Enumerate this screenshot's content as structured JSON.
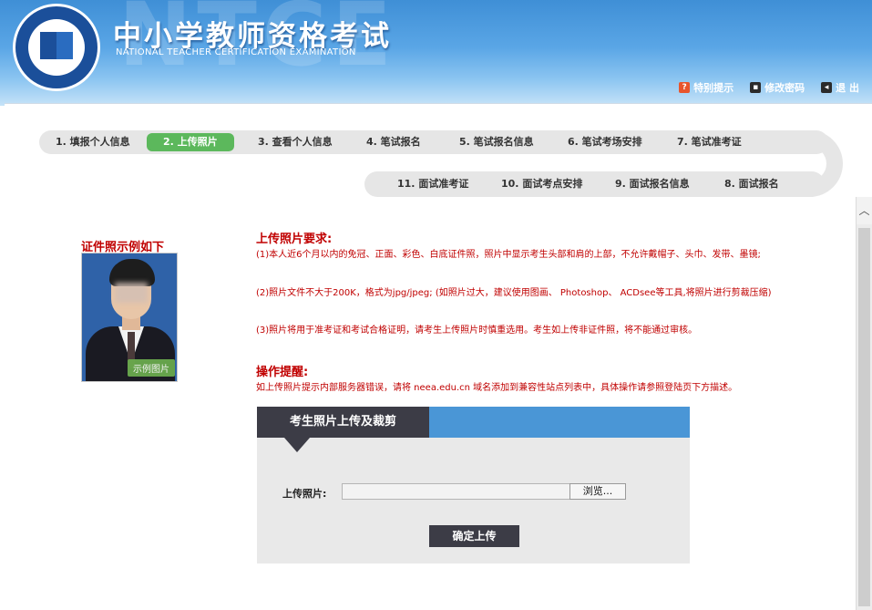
{
  "header": {
    "watermark": "NTCE",
    "title": "中小学教师资格考试",
    "subtitle": "NATIONAL TEACHER CERTIFICATION EXAMINATION",
    "links": [
      {
        "label": "特别提示",
        "icon": "notice-icon",
        "color": "#e8552d"
      },
      {
        "label": "修改密码",
        "icon": "password-icon",
        "color": "#2b2b2b"
      },
      {
        "label": "退 出",
        "icon": "logout-icon",
        "color": "#2b2b2b"
      }
    ]
  },
  "steps": {
    "top": [
      {
        "label": "1. 填报个人信息"
      },
      {
        "label": "2. 上传照片",
        "active": true
      },
      {
        "label": "3. 查看个人信息"
      },
      {
        "label": "4. 笔试报名"
      },
      {
        "label": "5. 笔试报名信息"
      },
      {
        "label": "6. 笔试考场安排"
      },
      {
        "label": "7. 笔试准考证"
      }
    ],
    "bottom": [
      {
        "label": "11. 面试准考证"
      },
      {
        "label": "10. 面试考点安排"
      },
      {
        "label": "9. 面试报名信息"
      },
      {
        "label": "8. 面试报名"
      }
    ],
    "active_color": "#5cb85c"
  },
  "sample": {
    "title": "证件照示例如下",
    "tag": "示例图片"
  },
  "requirements": {
    "title": "上传照片要求:",
    "items": [
      "(1)本人近6个月以内的免冠、正面、彩色、白底证件照，照片中显示考生头部和肩的上部，不允许戴帽子、头巾、发带、墨镜;",
      "(2)照片文件不大于200K，格式为jpg/jpeg;  (如照片过大，建议使用图画、 Photoshop、 ACDsee等工具,将照片进行剪裁压缩)",
      "(3)照片将用于准考证和考试合格证明，请考生上传照片时慎重选用。考生如上传非证件照，将不能通过审核。"
    ]
  },
  "tips": {
    "title": "操作提醒:",
    "text": "如上传照片提示内部服务器错误，请将 neea.edu.cn 域名添加到兼容性站点列表中，具体操作请参照登陆页下方描述。"
  },
  "upload": {
    "panel_title": "考生照片上传及裁剪",
    "field_label": "上传照片:",
    "file_value": "",
    "browse_label": "浏览...",
    "submit_label": "确定上传"
  },
  "colors": {
    "accent_red": "#c00000",
    "header_blue": "#4a96d6",
    "dark_button": "#3c3c46"
  }
}
